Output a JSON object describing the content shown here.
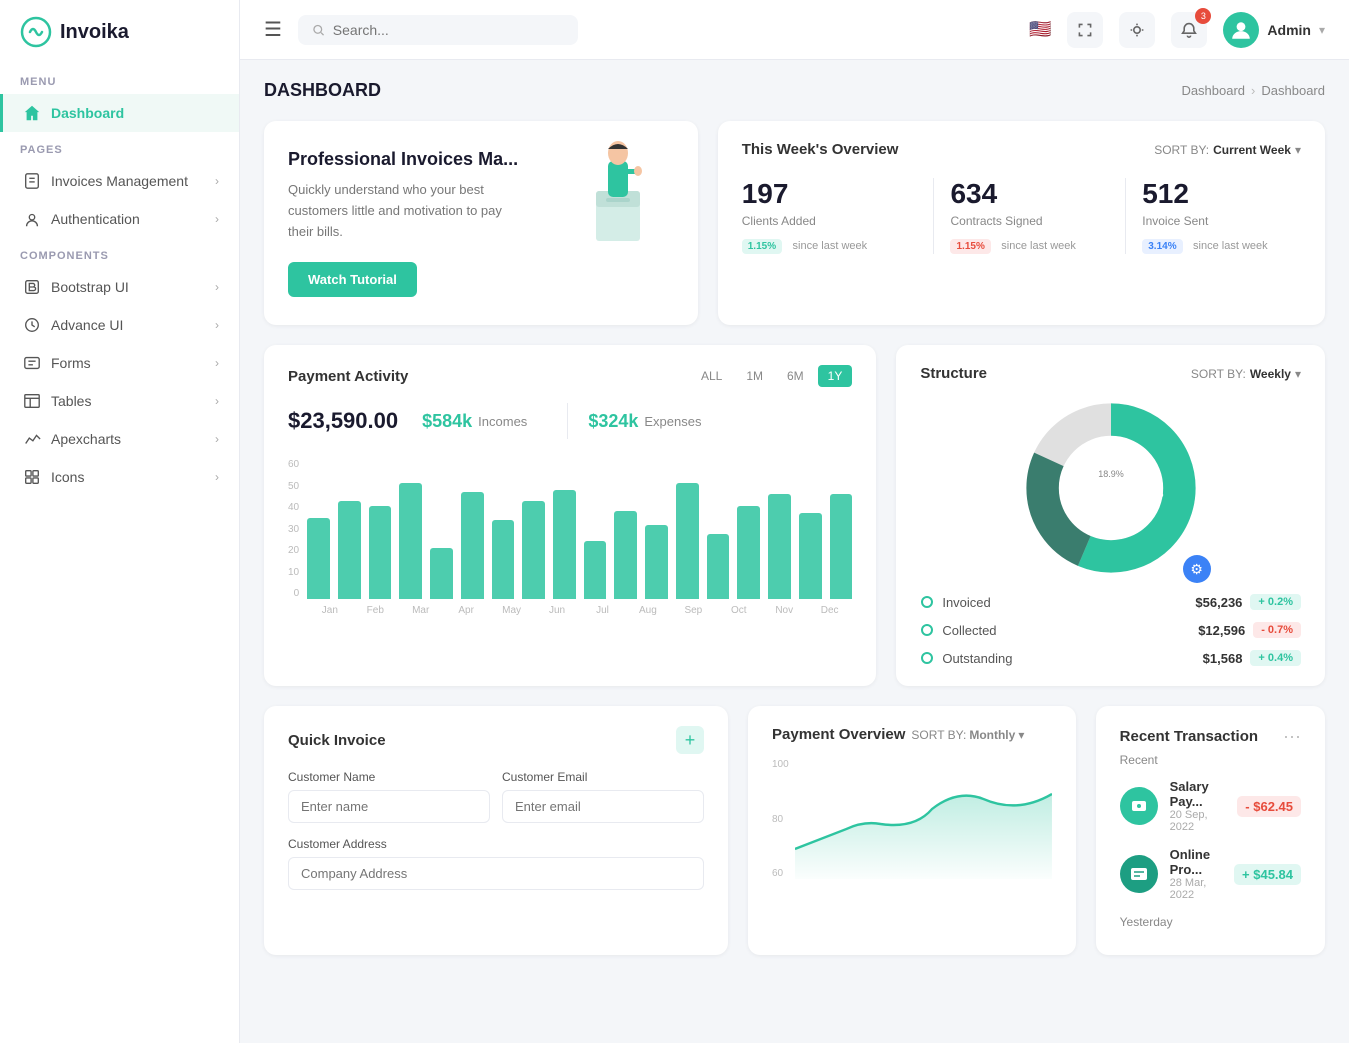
{
  "logo": {
    "text": "Invoika"
  },
  "sidebar": {
    "menu_label": "MENU",
    "pages_label": "PAGES",
    "components_label": "COMPONENTS",
    "items_menu": [
      {
        "id": "dashboard",
        "label": "Dashboard",
        "active": true
      }
    ],
    "items_pages": [
      {
        "id": "invoices",
        "label": "Invoices Management"
      },
      {
        "id": "authentication",
        "label": "Authentication"
      }
    ],
    "items_components": [
      {
        "id": "bootstrap",
        "label": "Bootstrap UI"
      },
      {
        "id": "advance",
        "label": "Advance UI"
      },
      {
        "id": "forms",
        "label": "Forms"
      },
      {
        "id": "tables",
        "label": "Tables"
      },
      {
        "id": "apexcharts",
        "label": "Apexcharts"
      },
      {
        "id": "icons",
        "label": "Icons"
      }
    ]
  },
  "header": {
    "search_placeholder": "Search...",
    "notification_count": "3",
    "user_name": "Admin"
  },
  "page_title": "DASHBOARD",
  "breadcrumb": [
    "Dashboard",
    "Dashboard"
  ],
  "welcome": {
    "title": "Professional Invoices Ma...",
    "description": "Quickly understand who your best customers little and motivation to pay their bills.",
    "button": "Watch Tutorial"
  },
  "stats": {
    "title": "This Week's Overview",
    "sort_label": "SORT BY:",
    "sort_value": "Current Week",
    "items": [
      {
        "number": "197",
        "label": "Clients Added",
        "badge": "1.15%",
        "badge_type": "green",
        "since": "since last week"
      },
      {
        "number": "634",
        "label": "Contracts Signed",
        "badge": "1.15%",
        "badge_type": "red",
        "since": "since last week"
      },
      {
        "number": "512",
        "label": "Invoice Sent",
        "badge": "3.14%",
        "badge_type": "blue",
        "since": "since last week"
      }
    ]
  },
  "payment_activity": {
    "title": "Payment Activity",
    "total": "$23,590.00",
    "income_amount": "$584k",
    "income_label": "Incomes",
    "expense_amount": "$324k",
    "expense_label": "Expenses",
    "filters": [
      "ALL",
      "1M",
      "6M",
      "1Y"
    ],
    "active_filter": "1Y",
    "chart_bars": [
      35,
      42,
      40,
      50,
      22,
      46,
      34,
      42,
      47,
      25,
      38,
      32,
      50,
      28,
      40,
      45,
      37,
      45
    ],
    "months": [
      "Jan",
      "Feb",
      "Mar",
      "Apr",
      "May",
      "Jun",
      "Jul",
      "Aug",
      "Sep",
      "Oct",
      "Nov",
      "Dec"
    ],
    "y_labels": [
      "60",
      "50",
      "40",
      "30",
      "20",
      "10",
      "0"
    ]
  },
  "structure": {
    "title": "Structure",
    "sort_label": "SORT BY:",
    "sort_value": "Weekly",
    "center_label": "18.9%",
    "segments": [
      {
        "pct": 56.3,
        "color": "#2ec4a0",
        "label_pos": "56.3%"
      },
      {
        "pct": 25.4,
        "color": "#3a7d6e",
        "label_pos": "25.4%"
      },
      {
        "pct": 18.3,
        "color": "#e0e0e0",
        "label_pos": ""
      }
    ],
    "legend": [
      {
        "name": "Invoiced",
        "value": "$56,236",
        "badge": "+ 0.2%",
        "badge_type": "pos"
      },
      {
        "name": "Collected",
        "value": "$12,596",
        "badge": "- 0.7%",
        "badge_type": "neg"
      },
      {
        "name": "Outstanding",
        "value": "$1,568",
        "badge": "+ 0.4%",
        "badge_type": "pos"
      }
    ]
  },
  "quick_invoice": {
    "title": "Quick Invoice",
    "fields": [
      {
        "label": "Customer Name",
        "placeholder": "Enter name"
      },
      {
        "label": "Customer Email",
        "placeholder": "Enter email"
      }
    ],
    "address_label": "Customer Address",
    "address_placeholder": "Company Address"
  },
  "payment_overview": {
    "title": "Payment Overview",
    "sort_label": "SORT BY:",
    "sort_value": "Monthly",
    "y_labels": [
      "100",
      "80",
      "60"
    ]
  },
  "recent_transactions": {
    "title": "Recent Transaction",
    "section_label": "Recent",
    "yesterday_label": "Yesterday",
    "items_recent": [
      {
        "name": "Salary Pay...",
        "date": "20 Sep, 2022",
        "amount": "- $62.45",
        "type": "neg",
        "icon": "P"
      },
      {
        "name": "Online Pro...",
        "date": "28 Mar, 2022",
        "amount": "+ $45.84",
        "type": "pos",
        "icon": "O"
      }
    ]
  }
}
